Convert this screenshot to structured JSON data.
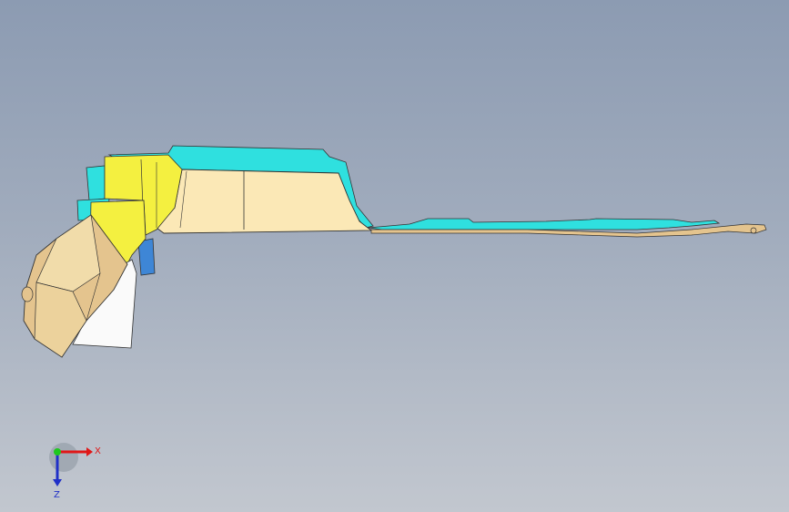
{
  "viewport": {
    "background_top": "#8c9bb2",
    "background_bottom": "#c2c7cf"
  },
  "colors": {
    "cream": "#fbe8b6",
    "tan": "#e4c48e",
    "yellow": "#f4f040",
    "cyan": "#2fe0df",
    "blue": "#3e86d6",
    "white": "#fafafa",
    "edge": "#333333"
  },
  "triad": {
    "x_label": "X",
    "z_label": "Z",
    "x_color": "#e01818",
    "y_color": "#1ec81e",
    "z_color": "#2030c8"
  },
  "model": {
    "part_name_icon": "sheet-metal-part-3d-icon"
  }
}
